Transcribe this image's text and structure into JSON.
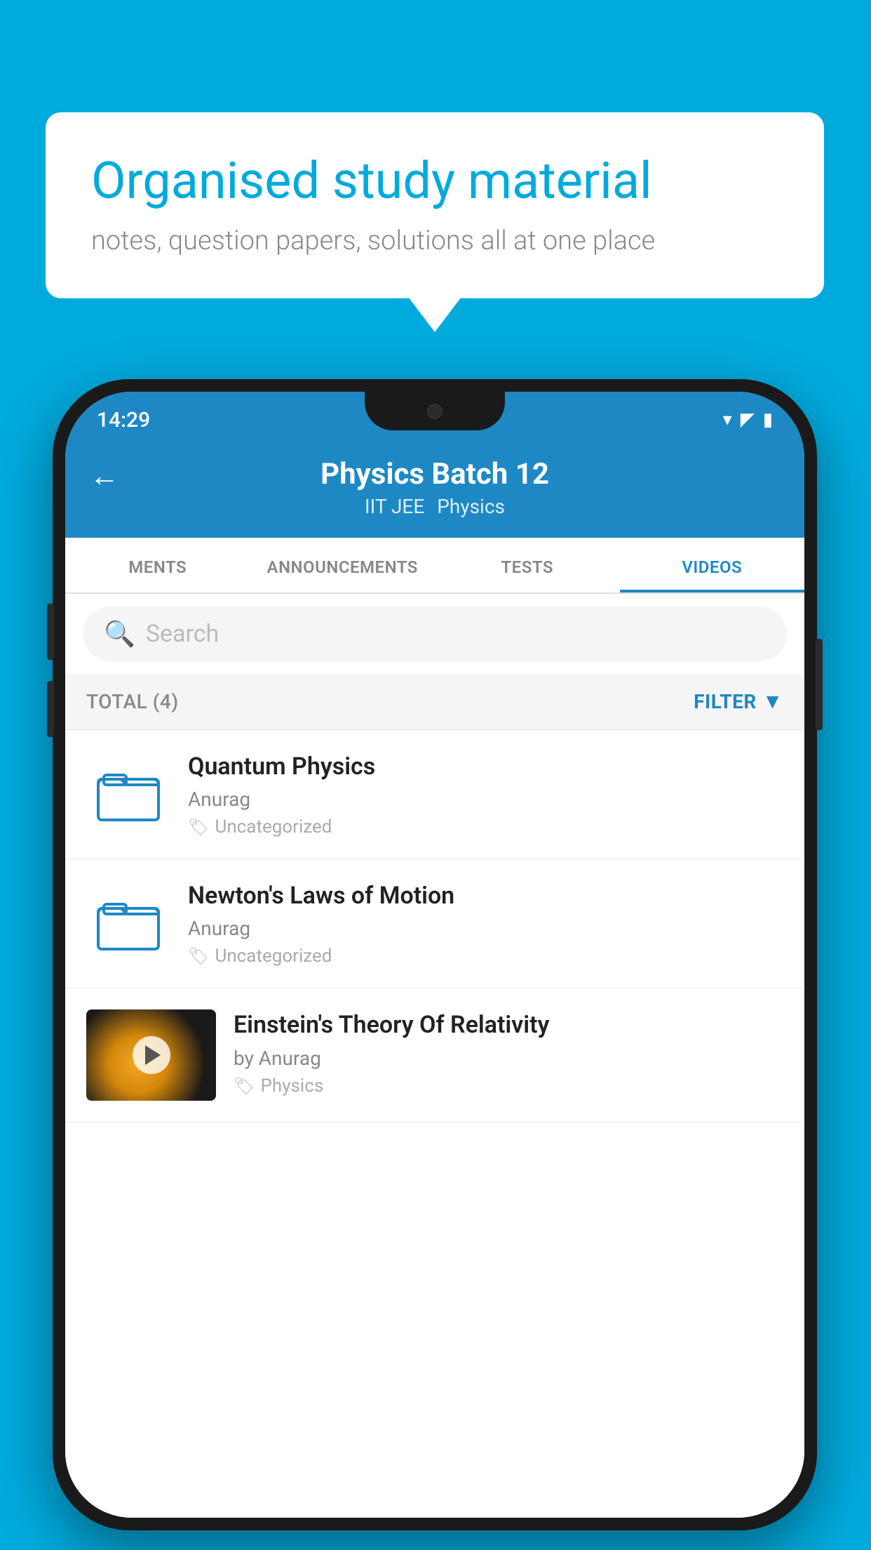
{
  "background_color": "#00AADD",
  "speech_bubble": {
    "title": "Organised study material",
    "subtitle": "notes, question papers, solutions all at one place"
  },
  "phone": {
    "status_bar": {
      "time": "14:29"
    },
    "header": {
      "back_label": "←",
      "title": "Physics Batch 12",
      "subtitle_part1": "IIT JEE",
      "subtitle_part2": "Physics"
    },
    "tabs": [
      {
        "label": "MENTS",
        "active": false
      },
      {
        "label": "ANNOUNCEMENTS",
        "active": false
      },
      {
        "label": "TESTS",
        "active": false
      },
      {
        "label": "VIDEOS",
        "active": true
      }
    ],
    "search": {
      "placeholder": "Search"
    },
    "filter_row": {
      "total_label": "TOTAL (4)",
      "filter_label": "FILTER"
    },
    "videos": [
      {
        "title": "Quantum Physics",
        "author": "Anurag",
        "tag": "Uncategorized",
        "has_thumbnail": false
      },
      {
        "title": "Newton's Laws of Motion",
        "author": "Anurag",
        "tag": "Uncategorized",
        "has_thumbnail": false
      },
      {
        "title": "Einstein's Theory Of Relativity",
        "author": "by Anurag",
        "tag": "Physics",
        "has_thumbnail": true
      }
    ]
  }
}
